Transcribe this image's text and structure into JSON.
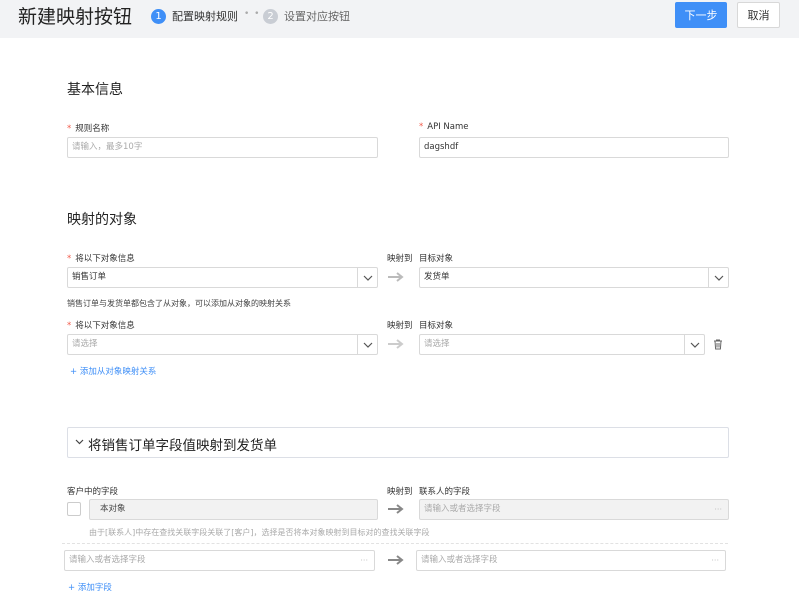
{
  "header": {
    "title": "新建映射按钮",
    "steps": [
      {
        "num": "1",
        "label": "配置映射规则"
      },
      {
        "num": "2",
        "label": "设置对应按钮"
      }
    ],
    "step_separator": "• •",
    "next_label": "下一步",
    "cancel_label": "取消"
  },
  "basic": {
    "title": "基本信息",
    "rule_name_label": "规则名称",
    "rule_name_placeholder": "请输入，最多10字",
    "api_label": "API  Name",
    "api_value": "dagshdf"
  },
  "mapping": {
    "title": "映射的对象",
    "source_label": "将以下对象信息",
    "maps_to": "映射到",
    "target_label": "目标对象",
    "source_value": "销售订单",
    "target_value": "发货单",
    "hint": "销售订单与发货单都包含了从对象，可以添加从对象的映射关系",
    "sub_source_label": "将以下对象信息",
    "sub_maps_to": "映射到",
    "sub_target_label": "目标对象",
    "sub_source_placeholder": "请选择",
    "sub_target_placeholder": "请选择",
    "add_sub_link": "+ 添加从对象映射关系"
  },
  "fields": {
    "collapse_title": "将销售订单字段值映射到发货单",
    "left_label": "客户中的字段",
    "maps_to": "映射到",
    "right_label": "联系人的字段",
    "fixed_left": "本对象",
    "fixed_right_placeholder": "请输入或者选择字段",
    "fixed_right_dots": "···",
    "notice": "由于[联系人]中存在查找关联字段关联了[客户]，选择是否将本对象映射到目标对的查找关联字段",
    "row_left_placeholder": "请输入或者选择字段",
    "row_right_placeholder": "请输入或者选择字段",
    "row_dots": "···",
    "add_field_link": "+ 添加字段"
  },
  "colors": {
    "accent": "#3f8ff7",
    "required": "#f25b4b",
    "header_bg": "#f2f3f5"
  },
  "icons": [
    "chevron-down-icon",
    "right-arrow-icon",
    "trash-icon",
    "chevron-collapse-icon"
  ]
}
